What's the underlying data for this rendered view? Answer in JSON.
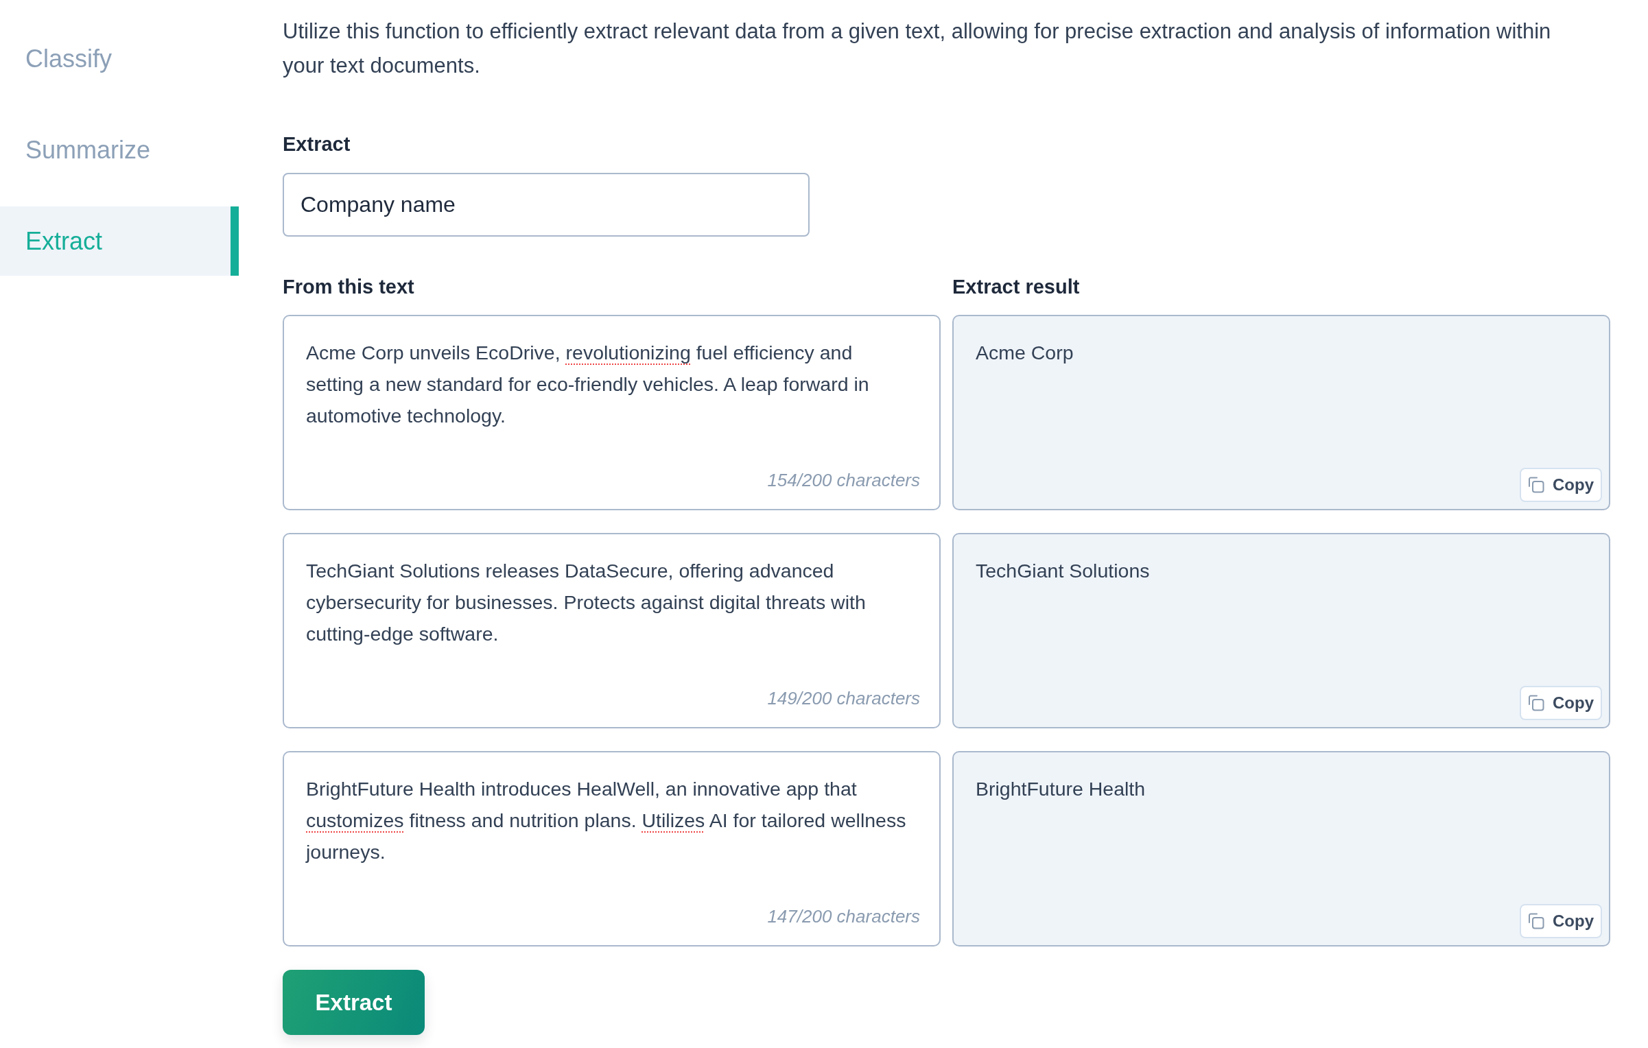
{
  "sidebar": {
    "items": [
      {
        "label": "Classify",
        "selected": false
      },
      {
        "label": "Summarize",
        "selected": false
      },
      {
        "label": "Extract",
        "selected": true
      }
    ]
  },
  "description": "Utilize this function to efficiently extract relevant data from a given text, allowing for precise extraction and analysis of information within your text documents.",
  "extract_field": {
    "label": "Extract",
    "value": "Company name"
  },
  "headings": {
    "source": "From this text",
    "result": "Extract result"
  },
  "rows": [
    {
      "source": {
        "segments": [
          {
            "text": "Acme Corp unveils EcoDrive, ",
            "flagged": false
          },
          {
            "text": "revolutionizing",
            "flagged": true
          },
          {
            "text": " fuel efficiency and setting a new standard for eco-friendly vehicles. A leap forward in automotive technology.",
            "flagged": false
          }
        ],
        "count": "154/200 characters"
      },
      "result": {
        "text": "Acme Corp",
        "copy_label": "Copy"
      }
    },
    {
      "source": {
        "segments": [
          {
            "text": "TechGiant Solutions releases DataSecure, offering advanced cybersecurity for businesses. Protects against digital threats with cutting-edge software.",
            "flagged": false
          }
        ],
        "count": "149/200 characters"
      },
      "result": {
        "text": "TechGiant Solutions",
        "copy_label": "Copy"
      }
    },
    {
      "source": {
        "segments": [
          {
            "text": "BrightFuture Health introduces HealWell, an innovative app that ",
            "flagged": false
          },
          {
            "text": "customizes",
            "flagged": true
          },
          {
            "text": " fitness and nutrition plans. ",
            "flagged": false
          },
          {
            "text": "Utilizes",
            "flagged": true
          },
          {
            "text": " AI for tailored wellness journeys.",
            "flagged": false
          }
        ],
        "count": "147/200 characters"
      },
      "result": {
        "text": "BrightFuture Health",
        "copy_label": "Copy"
      }
    }
  ],
  "submit_button": {
    "label": "Extract"
  }
}
